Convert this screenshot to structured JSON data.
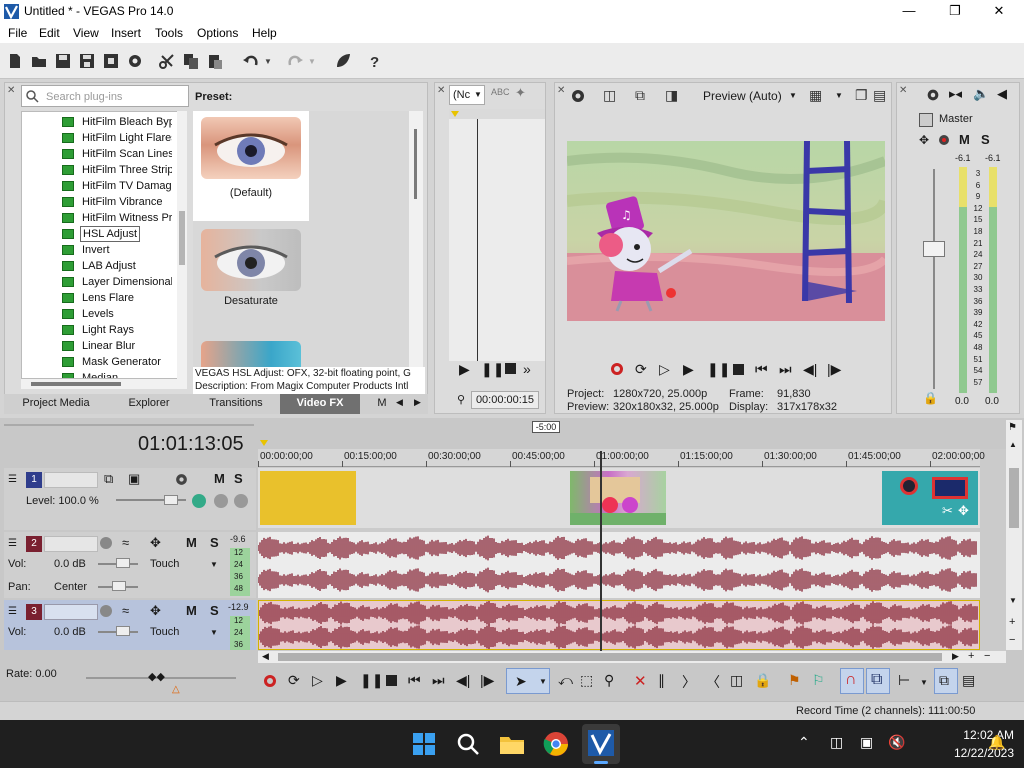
{
  "window": {
    "title": "Untitled * - VEGAS Pro 14.0",
    "minimize_icon": "minimize-icon",
    "maximize_icon": "restore-icon",
    "close_icon": "close-icon"
  },
  "menu": [
    "File",
    "Edit",
    "View",
    "Insert",
    "Tools",
    "Options",
    "Help"
  ],
  "plugin_browser": {
    "search_placeholder": "Search plug-ins",
    "preset_heading": "Preset:",
    "plugins": [
      "HitFilm Bleach Byp",
      "HitFilm Light Flares",
      "HitFilm Scan Lines",
      "HitFilm Three Strip",
      "HitFilm TV Damage",
      "HitFilm Vibrance",
      "HitFilm Witness Pr",
      "HSL Adjust",
      "Invert",
      "LAB Adjust",
      "Layer Dimensional",
      "Lens Flare",
      "Levels",
      "Light Rays",
      "Linear Blur",
      "Mask Generator",
      "Median"
    ],
    "selected_plugin": "HSL Adjust",
    "presets": [
      "(Default)",
      "Desaturate"
    ],
    "description_line1": "VEGAS HSL Adjust: OFX, 32-bit floating point, G",
    "description_line2": "Description: From Magix Computer Products Intl"
  },
  "dock_tabs": [
    "Project Media",
    "Explorer",
    "Transitions",
    "Video FX",
    "M"
  ],
  "active_dock_tab": "Video FX",
  "trimmer": {
    "dropdown": "(Nc",
    "timecode": "00:00:00:15"
  },
  "preview": {
    "quality": "Preview (Auto)",
    "project_label": "Project:",
    "project_value": "1280x720, 25.000p",
    "preview_label": "Preview:",
    "preview_value": "320x180x32, 25.000p",
    "frame_label": "Frame:",
    "frame_value": "91,830",
    "display_label": "Display:",
    "display_value": "317x178x32"
  },
  "mixer": {
    "title": "Master",
    "peak_left": "-6.1",
    "peak_right": "-6.1",
    "meter_scale": [
      "3",
      "6",
      "9",
      "12",
      "15",
      "18",
      "21",
      "24",
      "27",
      "30",
      "33",
      "36",
      "39",
      "42",
      "45",
      "48",
      "51",
      "54",
      "57"
    ],
    "fader_left": "0.0",
    "fader_right": "0.0"
  },
  "timeline": {
    "cursor_timecode": "01:01:13:05",
    "marker": "-5:00",
    "ruler": [
      "00:00:00;00",
      "00:15:00;00",
      "00:30:00;00",
      "00:45:00;00",
      "01:00:00;00",
      "01:15:00;00",
      "01:30:00;00",
      "01:45:00;00",
      "02:00:00;00"
    ],
    "tracks": [
      {
        "num": "1",
        "label": "Level: 100.0 %"
      },
      {
        "num": "2",
        "vol_label": "Vol:",
        "vol": "0.0 dB",
        "pan_label": "Pan:",
        "pan": "Center",
        "touch": "Touch",
        "meter_top": "-9.6",
        "meter_scale": [
          "12",
          "24",
          "36",
          "48"
        ]
      },
      {
        "num": "3",
        "vol_label": "Vol:",
        "vol": "0.0 dB",
        "touch": "Touch",
        "meter_top": "-12.9",
        "meter_scale": [
          "12",
          "24",
          "36"
        ]
      }
    ],
    "mute": "M",
    "solo": "S",
    "rate": "Rate: 0.00"
  },
  "status": {
    "record_time": "Record Time (2 channels): 111:00:50"
  },
  "taskbar": {
    "time": "12:02 AM",
    "date": "12/22/2023"
  },
  "colors": {
    "audio_wave": "#8a2a3a",
    "video_clip_yellow": "#e9c12c",
    "video_clip_teal": "#35a8ac",
    "track_video_color": "#2f3d8c",
    "track_audio_color": "#7a2030"
  }
}
